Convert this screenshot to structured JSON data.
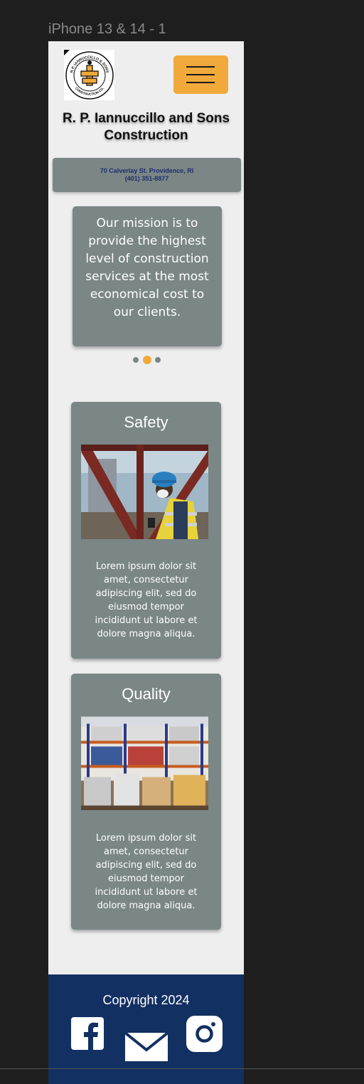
{
  "frame": {
    "label": "iPhone 13 & 14 - 1"
  },
  "header": {
    "company_name": "R. P. Iannuccillo and Sons Construction",
    "logo_top_text": "R.P. IANNUCCILLO & SONS",
    "logo_bottom_text": "CONSTRUCTION CO.",
    "menu_icon": "hamburger-icon"
  },
  "contact": {
    "address": "70 Calverlay St. Providence, RI",
    "phone": "(401) 351-8877"
  },
  "mission": {
    "text": "Our mission is to provide the highest level of construction services at the most economical cost to our clients.",
    "carousel_active_index": 1,
    "carousel_count": 3
  },
  "cards": [
    {
      "title": "Safety",
      "text": "Lorem  ipsum dolor sit amet, consectetur adipiscing elit, sed do eiusmod  tempor incididunt ut labore et dolore magna aliqua.",
      "image": "construction-worker-photo"
    },
    {
      "title": "Quality",
      "text": "Lorem  ipsum dolor sit amet, consectetur adipiscing elit, sed do eiusmod  tempor incididunt ut labore et dolore magna aliqua.",
      "image": "warehouse-materials-photo"
    }
  ],
  "footer": {
    "copyright": "Copyright 2024",
    "icons": [
      "facebook-icon",
      "mail-icon",
      "instagram-icon"
    ]
  },
  "colors": {
    "accent": "#f2a93b",
    "card": "#7b8686",
    "footer": "#133062",
    "page": "#eeeeee"
  }
}
